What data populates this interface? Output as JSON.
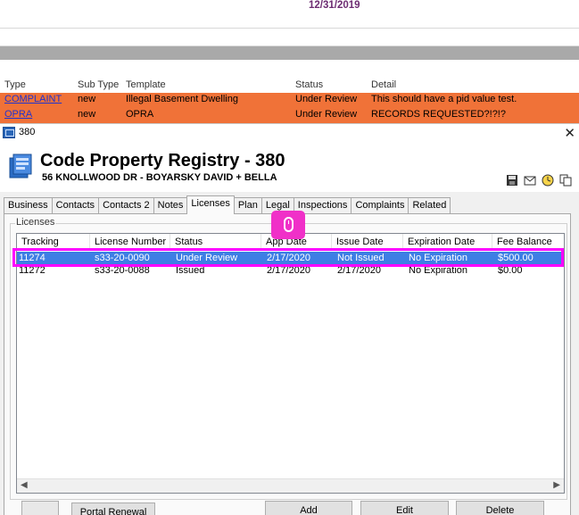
{
  "background": {
    "date": "12/31/2019",
    "columns": [
      "Type",
      "Sub Type",
      "Template",
      "Status",
      "Detail"
    ],
    "rows": [
      {
        "type": "COMPLAINT",
        "subtype": "new",
        "template": "Illegal Basement Dwelling",
        "status": "Under Review",
        "detail": "This should have a pid value test."
      },
      {
        "type": "OPRA",
        "subtype": "new",
        "template": "OPRA",
        "status": "Under Review",
        "detail": "RECORDS REQUESTED?!?!?"
      }
    ]
  },
  "window": {
    "title": "380",
    "heading": "Code Property Registry - 380",
    "subheading": "56 KNOLLWOOD DR - BOYARSKY DAVID + BELLA"
  },
  "tabs": [
    "Business",
    "Contacts",
    "Contacts 2",
    "Notes",
    "Licenses",
    "Plan",
    "Legal",
    "Inspections",
    "Complaints",
    "Related"
  ],
  "active_tab": "Licenses",
  "licenses": {
    "group_label": "Licenses",
    "columns": [
      "Tracking",
      "License Number",
      "Status",
      "App Date",
      "Issue Date",
      "Expiration Date",
      "Fee Balance"
    ],
    "rows": [
      {
        "tracking": "11274",
        "license": "s33-20-0090",
        "status": "Under Review",
        "app_date": "2/17/2020",
        "issue_date": "Not Issued",
        "expiration": "No Expiration",
        "fee": "$500.00"
      },
      {
        "tracking": "11272",
        "license": "s33-20-0088",
        "status": "Issued",
        "app_date": "2/17/2020",
        "issue_date": "2/17/2020",
        "expiration": "No Expiration",
        "fee": "$0.00"
      }
    ]
  },
  "buttons": {
    "portal_renewal": "Portal Renewal",
    "add": "Add",
    "edit": "Edit",
    "delete": "Delete"
  },
  "colors": {
    "accent_row": "#f07238",
    "selection": "#3e7ee4",
    "highlight": "#ff00ff",
    "date": "#6d2c72"
  }
}
